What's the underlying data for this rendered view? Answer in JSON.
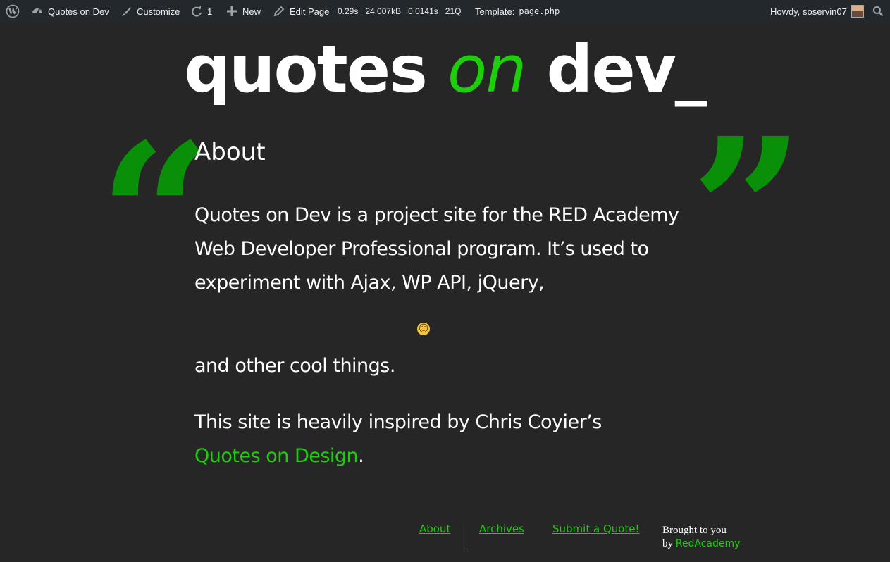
{
  "adminbar": {
    "site_name": "Quotes on Dev",
    "customize": "Customize",
    "updates_count": "1",
    "new": "New",
    "edit_page": "Edit Page",
    "stats": [
      "0.29s",
      "24,007kB",
      "0.0141s",
      "21Q"
    ],
    "template_label": "Template:",
    "template_file": "page.php",
    "howdy": "Howdy, soservin07"
  },
  "header": {
    "logo_part1": "quotes ",
    "logo_part2": "on",
    "logo_part3": " dev_"
  },
  "quote_marks": {
    "open": "“",
    "close": "”"
  },
  "content": {
    "title": "About",
    "para1": "Quotes on Dev is a project site for the RED Academy Web Developer Professional program. It’s used to experiment with Ajax, WP API, jQuery,",
    "para2": "and other cool things.",
    "para3_prefix": "This site is heavily inspired by Chris Coyier’s",
    "para3_link": "Quotes on Design",
    "para3_suffix": "."
  },
  "footer": {
    "nav": [
      "About",
      "Archives",
      "Submit a Quote!"
    ],
    "brought_line1": "Brought to you",
    "brought_by": "by",
    "brought_link": "RedAcademy"
  },
  "colors": {
    "accent": "#1ecd0b",
    "quote_mark": "#0a8f08",
    "background": "#262626",
    "adminbar": "#23282d"
  }
}
